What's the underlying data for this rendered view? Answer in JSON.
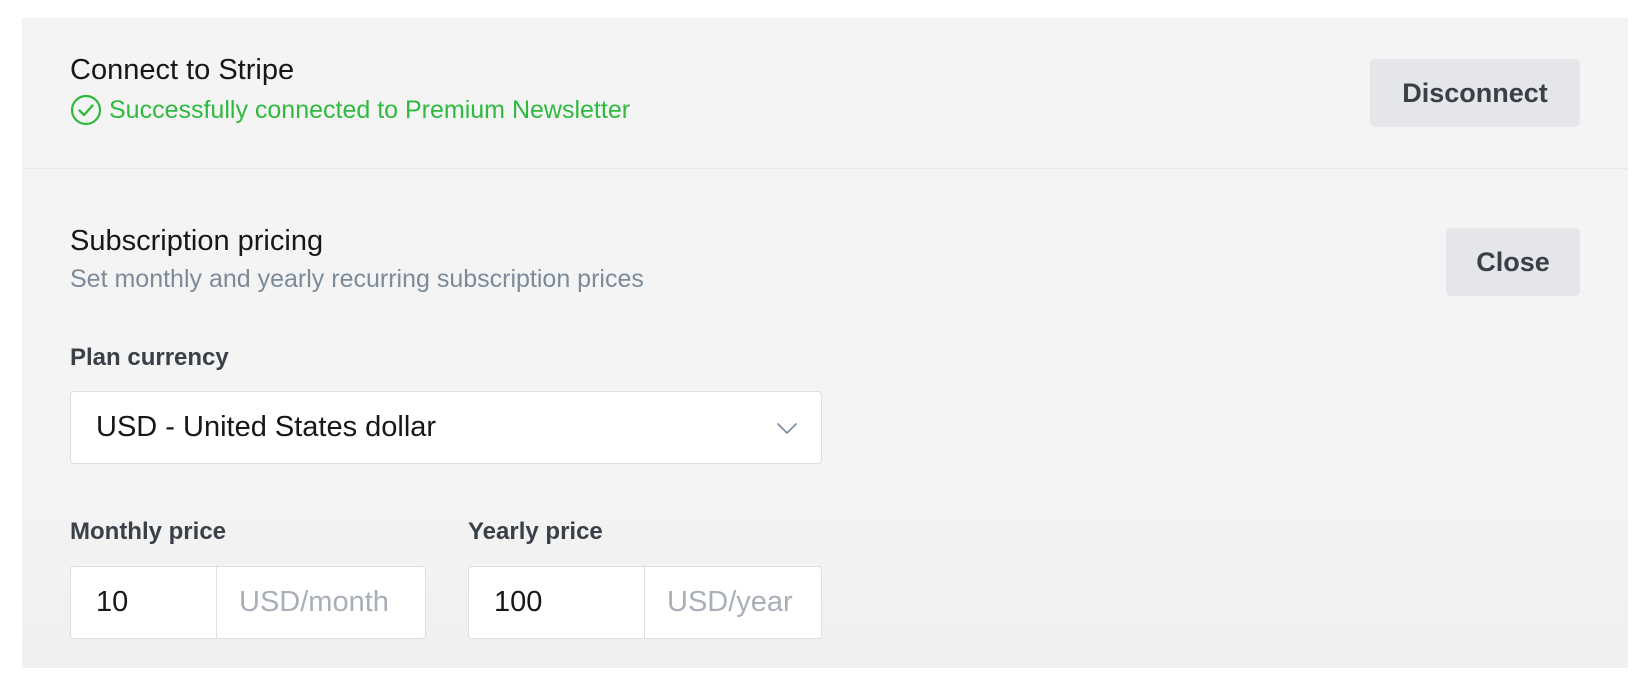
{
  "stripe": {
    "title": "Connect to Stripe",
    "status_text": "Successfully connected to Premium Newsletter",
    "status_color": "#2fba3f",
    "status_icon": "check-circle-icon",
    "disconnect_label": "Disconnect"
  },
  "pricing": {
    "title": "Subscription pricing",
    "subtitle": "Set monthly and yearly recurring subscription prices",
    "close_label": "Close",
    "currency": {
      "label": "Plan currency",
      "selected": "USD - United States dollar",
      "icon": "chevron-down-icon"
    },
    "monthly": {
      "label": "Monthly price",
      "value": "10",
      "unit": "USD/month"
    },
    "yearly": {
      "label": "Yearly price",
      "value": "100",
      "unit": "USD/year"
    }
  },
  "colors": {
    "panel_background": "#f4f4f4",
    "button_background": "#e4e6e9",
    "subtitle_text": "#7c8b9a"
  }
}
